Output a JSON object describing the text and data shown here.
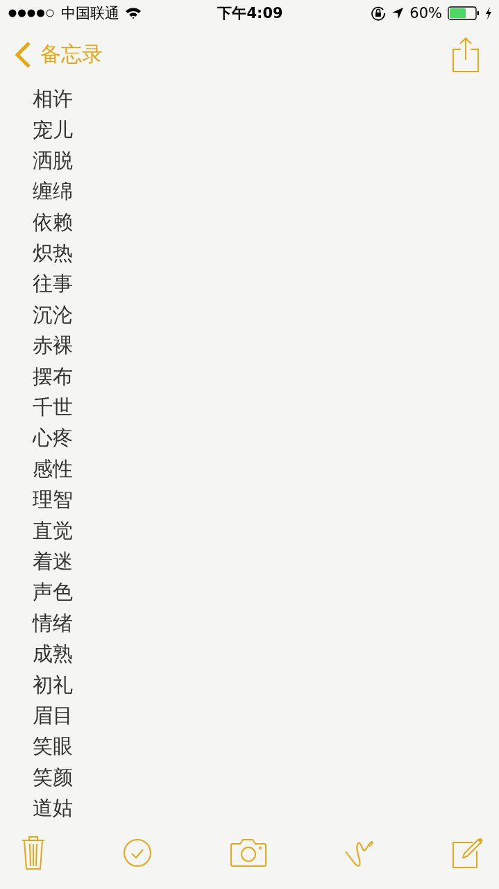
{
  "status_bar": {
    "carrier": "中国联通",
    "time": "下午4:09",
    "battery": "60%"
  },
  "nav": {
    "back": "备忘录"
  },
  "note_lines": [
    "相许",
    "宠儿",
    "洒脱",
    "缠绵",
    "依赖",
    "炽热",
    "往事",
    "沉沦",
    "赤裸",
    "摆布",
    "千世",
    "心疼",
    "感性",
    "理智",
    "直觉",
    "着迷",
    "声色",
    "情绪",
    "成熟",
    "初礼",
    "眉目",
    "笑眼",
    "笑颜",
    "道姑"
  ]
}
